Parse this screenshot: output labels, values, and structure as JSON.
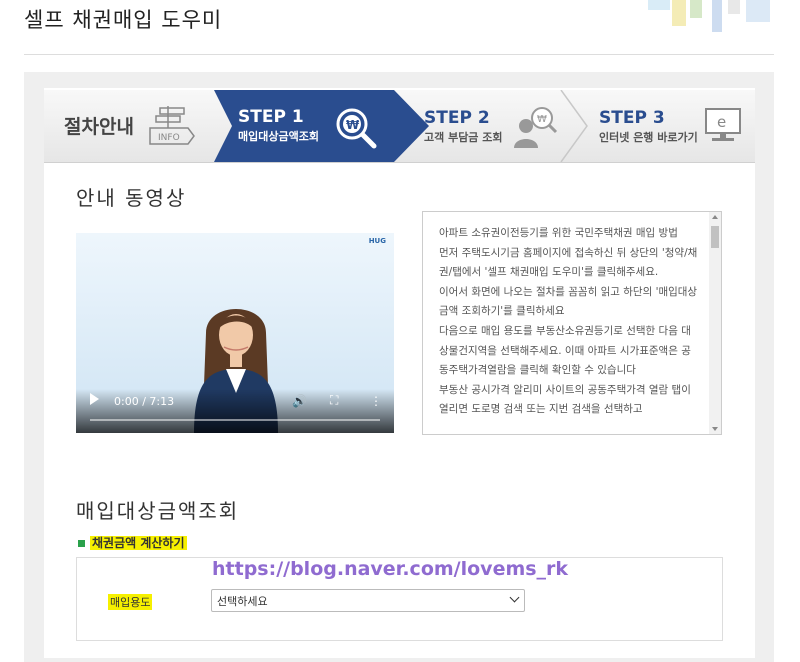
{
  "page": {
    "title": "셀프 채권매입 도우미"
  },
  "steps": {
    "guide_label": "절차안내",
    "info_icon_text": "INFO",
    "step1": {
      "title": "STEP 1",
      "subtitle": "매입대상금액조회"
    },
    "step2": {
      "title": "STEP 2",
      "subtitle": "고객 부담금 조회"
    },
    "step3": {
      "title": "STEP 3",
      "subtitle": "인터넷 은행 바로가기"
    }
  },
  "video_section": {
    "title": "안내 동영상",
    "logo_text": "HUG",
    "time": "0:00 / 7:13",
    "progress": 0,
    "description": [
      "아파트 소유권이전등기를 위한 국민주택채권 매입 방법",
      "먼저 주택도시기금 홈페이지에 접속하신 뒤 상단의 '청약/채권/탭에서 '셀프 채권매입 도우미'를 클릭해주세요.",
      "이어서 화면에 나오는 절차를 꼼꼼히 읽고 하단의 '매입대상금액 조회하기'를 클릭하세요",
      "다음으로 매입 용도를 부동산소유권등기로 선택한 다음 대상물건지역을 선택해주세요. 이때 아파트 시가표준액은 공동주택가격열람을 클릭해 확인할 수 있습니다",
      "부동산 공시가격 알리미 사이트의 공동주택가격 열람 탭이 열리면 도로명 검색 또는 지번 검색을 선택하고"
    ]
  },
  "lookup_section": {
    "title": "매입대상금액조회",
    "calc_label": "채권금액 계산하기",
    "watermark": "https://blog.naver.com/lovems_rk",
    "field_label": "매입용도",
    "select_value": "선택하세요"
  },
  "colors": {
    "step_active": "#2a4d8f",
    "highlight": "#f6f000",
    "watermark": "#8f6bd0"
  }
}
